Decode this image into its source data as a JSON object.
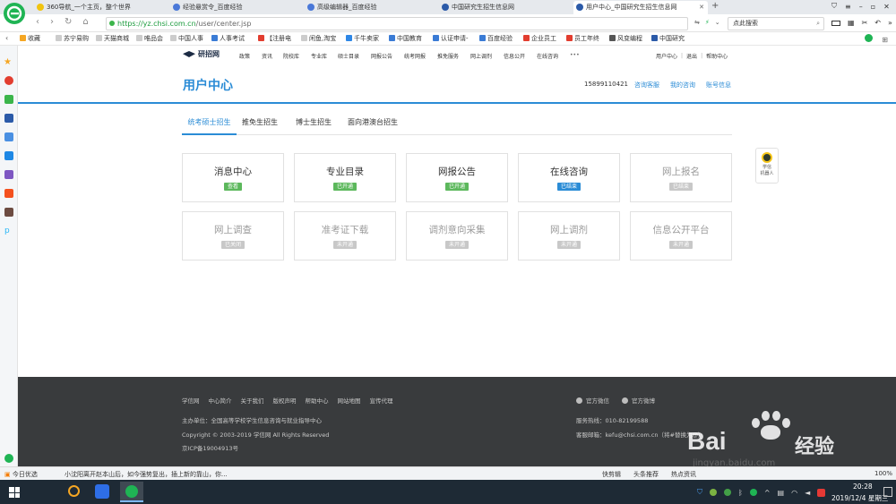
{
  "browser": {
    "tabs": [
      {
        "title": "360导航_一个主页，整个世界",
        "icon_color": "#f1c40f"
      },
      {
        "title": "经验悬赏令_百度经验",
        "icon_color": "#4a78d8"
      },
      {
        "title": "高级编辑器_百度经验",
        "icon_color": "#4a78d8"
      },
      {
        "title": "中国研究生招生信息网",
        "icon_color": "#2b5aa8"
      },
      {
        "title": "用户中心_中国研究生招生信息网",
        "icon_color": "#2b5aa8"
      }
    ],
    "new_tab": "+",
    "url": "https://yz.chsi.com.cn/user/center.jsp",
    "url_host": "https://yz.chsi.com.cn",
    "url_path": "/user/center.jsp",
    "search_placeholder": "点此搜索",
    "bookmarks": [
      {
        "label": "收藏",
        "color": "#f5a623"
      },
      {
        "label": "苏宁易购",
        "color": "#bbbbbb"
      },
      {
        "label": "天猫商城",
        "color": "#bbbbbb"
      },
      {
        "label": "唯品会",
        "color": "#bbbbbb"
      },
      {
        "label": "中国人事",
        "color": "#bbbbbb"
      },
      {
        "label": "人事考试",
        "color": "#3a7bd5"
      },
      {
        "label": "【注册电",
        "color": "#e23d2f"
      },
      {
        "label": "闲鱼,淘宝",
        "color": "#bbbbbb"
      },
      {
        "label": "千牛卖家",
        "color": "#2e87e6"
      },
      {
        "label": "中国教育",
        "color": "#3a7bd5"
      },
      {
        "label": "认证申请-",
        "color": "#3a7bd5"
      },
      {
        "label": "百度经验",
        "color": "#3a7bd5"
      },
      {
        "label": "企业员工",
        "color": "#e23d2f"
      },
      {
        "label": "员工年终",
        "color": "#e23d2f"
      },
      {
        "label": "风变编程",
        "color": "#555555"
      },
      {
        "label": "中国研究",
        "color": "#2b5aa8"
      }
    ]
  },
  "site": {
    "logo": "研招网",
    "nav": [
      "政策",
      "资讯",
      "院校库",
      "专业库",
      "硕士目录",
      "网报公告",
      "统考网报",
      "推免服务",
      "网上调剂",
      "信息公开",
      "在线咨询",
      "•••"
    ],
    "top_right": [
      "用户中心",
      "|",
      "退出",
      "|",
      "帮助中心"
    ],
    "page_title": "用户中心",
    "phone": "15899110421",
    "header_links": [
      "咨询客服",
      "我的咨询",
      "账号信息"
    ],
    "tabs": [
      "统考硕士招生",
      "推免生招生",
      "博士生招生",
      "面向港澳台招生"
    ],
    "cards": [
      {
        "title": "消息中心",
        "badge": "查看",
        "color": "#5cb85c",
        "off": false
      },
      {
        "title": "专业目录",
        "badge": "已开通",
        "color": "#5cb85c",
        "off": false
      },
      {
        "title": "网报公告",
        "badge": "已开通",
        "color": "#5cb85c",
        "off": false
      },
      {
        "title": "在线咨询",
        "badge": "已结束",
        "color": "#2b8cd6",
        "off": false
      },
      {
        "title": "网上报名",
        "badge": "已结束",
        "color": "#c8c8c8",
        "off": true
      },
      {
        "title": "网上调查",
        "badge": "已关闭",
        "color": "#c8c8c8",
        "off": true
      },
      {
        "title": "准考证下载",
        "badge": "未开通",
        "color": "#c8c8c8",
        "off": true
      },
      {
        "title": "调剂意向采集",
        "badge": "未开通",
        "color": "#c8c8c8",
        "off": true
      },
      {
        "title": "网上调剂",
        "badge": "未开通",
        "color": "#c8c8c8",
        "off": true
      },
      {
        "title": "信息公开平台",
        "badge": "未开通",
        "color": "#c8c8c8",
        "off": true
      }
    ],
    "robot_label_1": "学信",
    "robot_label_2": "机器人",
    "footer": {
      "links": [
        "学信网",
        "中心简介",
        "关于我们",
        "版权声明",
        "帮助中心",
        "网站地图",
        "宣传代理"
      ],
      "org": "主办单位：全国高等学校学生信息咨询与就业指导中心",
      "copyright": "Copyright © 2003-2019 学信网 All Rights Reserved",
      "icp": "京ICP备19004913号",
      "wechat": "官方微信",
      "weibo": "官方微博",
      "hotline": "服务热线：010-82199588",
      "email": "客服邮箱：kefu@chsi.com.cn（将#替换为@）"
    }
  },
  "status": {
    "left": "今日优选",
    "news": "小沈阳离开赵本山后，如今强势复出，插上新的靠山，你...",
    "right_items": [
      "快剪辑",
      "头条推荐",
      "热点资讯"
    ],
    "zoom": "100%"
  },
  "taskbar": {
    "time": "20:28",
    "date": "2019/12/4 星期三"
  },
  "watermark": {
    "text": "Bai",
    "suffix": "经验",
    "sub": "jingyan.baidu.com"
  }
}
